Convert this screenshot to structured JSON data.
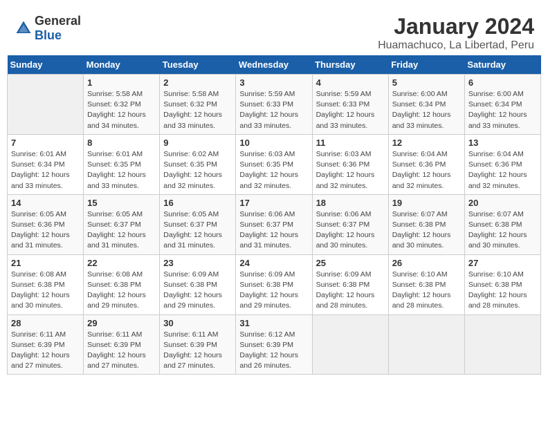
{
  "header": {
    "logo_general": "General",
    "logo_blue": "Blue",
    "title": "January 2024",
    "subtitle": "Huamachuco, La Libertad, Peru"
  },
  "days_of_week": [
    "Sunday",
    "Monday",
    "Tuesday",
    "Wednesday",
    "Thursday",
    "Friday",
    "Saturday"
  ],
  "weeks": [
    [
      {
        "day": "",
        "info": ""
      },
      {
        "day": "1",
        "info": "Sunrise: 5:58 AM\nSunset: 6:32 PM\nDaylight: 12 hours\nand 34 minutes."
      },
      {
        "day": "2",
        "info": "Sunrise: 5:58 AM\nSunset: 6:32 PM\nDaylight: 12 hours\nand 33 minutes."
      },
      {
        "day": "3",
        "info": "Sunrise: 5:59 AM\nSunset: 6:33 PM\nDaylight: 12 hours\nand 33 minutes."
      },
      {
        "day": "4",
        "info": "Sunrise: 5:59 AM\nSunset: 6:33 PM\nDaylight: 12 hours\nand 33 minutes."
      },
      {
        "day": "5",
        "info": "Sunrise: 6:00 AM\nSunset: 6:34 PM\nDaylight: 12 hours\nand 33 minutes."
      },
      {
        "day": "6",
        "info": "Sunrise: 6:00 AM\nSunset: 6:34 PM\nDaylight: 12 hours\nand 33 minutes."
      }
    ],
    [
      {
        "day": "7",
        "info": "Sunrise: 6:01 AM\nSunset: 6:34 PM\nDaylight: 12 hours\nand 33 minutes."
      },
      {
        "day": "8",
        "info": "Sunrise: 6:01 AM\nSunset: 6:35 PM\nDaylight: 12 hours\nand 33 minutes."
      },
      {
        "day": "9",
        "info": "Sunrise: 6:02 AM\nSunset: 6:35 PM\nDaylight: 12 hours\nand 32 minutes."
      },
      {
        "day": "10",
        "info": "Sunrise: 6:03 AM\nSunset: 6:35 PM\nDaylight: 12 hours\nand 32 minutes."
      },
      {
        "day": "11",
        "info": "Sunrise: 6:03 AM\nSunset: 6:36 PM\nDaylight: 12 hours\nand 32 minutes."
      },
      {
        "day": "12",
        "info": "Sunrise: 6:04 AM\nSunset: 6:36 PM\nDaylight: 12 hours\nand 32 minutes."
      },
      {
        "day": "13",
        "info": "Sunrise: 6:04 AM\nSunset: 6:36 PM\nDaylight: 12 hours\nand 32 minutes."
      }
    ],
    [
      {
        "day": "14",
        "info": "Sunrise: 6:05 AM\nSunset: 6:36 PM\nDaylight: 12 hours\nand 31 minutes."
      },
      {
        "day": "15",
        "info": "Sunrise: 6:05 AM\nSunset: 6:37 PM\nDaylight: 12 hours\nand 31 minutes."
      },
      {
        "day": "16",
        "info": "Sunrise: 6:05 AM\nSunset: 6:37 PM\nDaylight: 12 hours\nand 31 minutes."
      },
      {
        "day": "17",
        "info": "Sunrise: 6:06 AM\nSunset: 6:37 PM\nDaylight: 12 hours\nand 31 minutes."
      },
      {
        "day": "18",
        "info": "Sunrise: 6:06 AM\nSunset: 6:37 PM\nDaylight: 12 hours\nand 30 minutes."
      },
      {
        "day": "19",
        "info": "Sunrise: 6:07 AM\nSunset: 6:38 PM\nDaylight: 12 hours\nand 30 minutes."
      },
      {
        "day": "20",
        "info": "Sunrise: 6:07 AM\nSunset: 6:38 PM\nDaylight: 12 hours\nand 30 minutes."
      }
    ],
    [
      {
        "day": "21",
        "info": "Sunrise: 6:08 AM\nSunset: 6:38 PM\nDaylight: 12 hours\nand 30 minutes."
      },
      {
        "day": "22",
        "info": "Sunrise: 6:08 AM\nSunset: 6:38 PM\nDaylight: 12 hours\nand 29 minutes."
      },
      {
        "day": "23",
        "info": "Sunrise: 6:09 AM\nSunset: 6:38 PM\nDaylight: 12 hours\nand 29 minutes."
      },
      {
        "day": "24",
        "info": "Sunrise: 6:09 AM\nSunset: 6:38 PM\nDaylight: 12 hours\nand 29 minutes."
      },
      {
        "day": "25",
        "info": "Sunrise: 6:09 AM\nSunset: 6:38 PM\nDaylight: 12 hours\nand 28 minutes."
      },
      {
        "day": "26",
        "info": "Sunrise: 6:10 AM\nSunset: 6:38 PM\nDaylight: 12 hours\nand 28 minutes."
      },
      {
        "day": "27",
        "info": "Sunrise: 6:10 AM\nSunset: 6:38 PM\nDaylight: 12 hours\nand 28 minutes."
      }
    ],
    [
      {
        "day": "28",
        "info": "Sunrise: 6:11 AM\nSunset: 6:39 PM\nDaylight: 12 hours\nand 27 minutes."
      },
      {
        "day": "29",
        "info": "Sunrise: 6:11 AM\nSunset: 6:39 PM\nDaylight: 12 hours\nand 27 minutes."
      },
      {
        "day": "30",
        "info": "Sunrise: 6:11 AM\nSunset: 6:39 PM\nDaylight: 12 hours\nand 27 minutes."
      },
      {
        "day": "31",
        "info": "Sunrise: 6:12 AM\nSunset: 6:39 PM\nDaylight: 12 hours\nand 26 minutes."
      },
      {
        "day": "",
        "info": ""
      },
      {
        "day": "",
        "info": ""
      },
      {
        "day": "",
        "info": ""
      }
    ]
  ]
}
